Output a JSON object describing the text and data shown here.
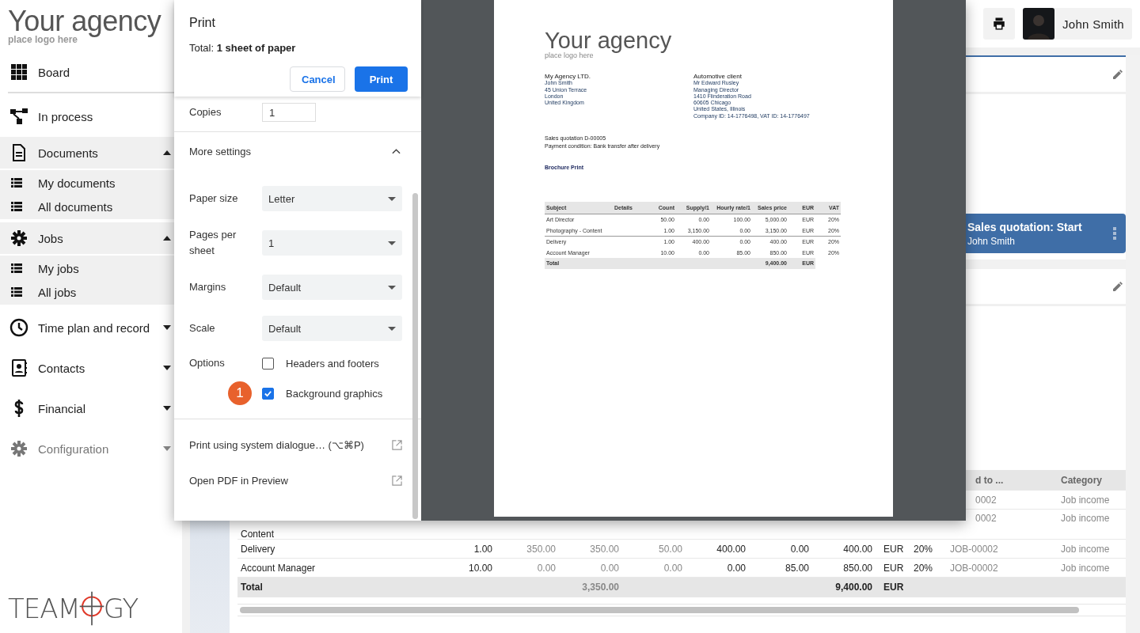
{
  "brand": {
    "name": "Your agency",
    "tagline": "place logo here"
  },
  "sidebar": {
    "items": [
      {
        "label": "Board",
        "disabled": false
      },
      {
        "label": "In process",
        "disabled": false
      },
      {
        "label": "Documents",
        "disabled": false,
        "expanded": true,
        "children": [
          {
            "label": "My documents"
          },
          {
            "label": "All documents"
          }
        ]
      },
      {
        "label": "Jobs",
        "disabled": false,
        "expanded": true,
        "children": [
          {
            "label": "My jobs"
          },
          {
            "label": "All jobs"
          }
        ]
      },
      {
        "label": "Time plan and record",
        "disabled": false,
        "expanded": false
      },
      {
        "label": "Contacts",
        "disabled": false,
        "expanded": false
      },
      {
        "label": "Financial",
        "disabled": false,
        "expanded": false
      },
      {
        "label": "Configuration",
        "disabled": true,
        "expanded": false
      }
    ],
    "footer_logo": {
      "left": "TEAM",
      "right": "GY"
    }
  },
  "header": {
    "user": {
      "name": "John Smith"
    }
  },
  "board": {
    "card": {
      "title": "Sales quotation: Start",
      "subtitle": "John Smith"
    }
  },
  "table": {
    "header": {
      "job": "d to ...",
      "category": "Category"
    },
    "rows": [
      {
        "kind": "item",
        "job": "0002",
        "category": "Job income"
      },
      {
        "kind": "item",
        "subject": "Content",
        "job": "0002",
        "category": "Job income"
      },
      {
        "kind": "item",
        "subject": "Delivery",
        "values": [
          "1.00",
          "350.00",
          "350.00",
          "50.00",
          "400.00",
          "0.00",
          "400.00"
        ],
        "currency": "EUR",
        "vat": "20%",
        "job": "JOB-00002",
        "category": "Job income"
      },
      {
        "kind": "item",
        "subject": "Account Manager",
        "values": [
          "10.00",
          "0.00",
          "0.00",
          "0.00",
          "0.00",
          "85.00",
          "850.00"
        ],
        "currency": "EUR",
        "vat": "20%",
        "job": "JOB-00002",
        "category": "Job income"
      },
      {
        "kind": "total",
        "subject": "Total",
        "column_4": "3,350.00",
        "column_8": "9,400.00",
        "currency": "EUR"
      }
    ]
  },
  "print_dialog": {
    "title": "Print",
    "total": "Total: **1 sheet of paper**",
    "buttons": [
      {
        "label": "Cancel",
        "kind": "secondary"
      },
      {
        "label": "Print",
        "kind": "primary"
      }
    ],
    "copies": {
      "label": "Copies",
      "value": "1"
    },
    "more_settings": {
      "label": "More settings",
      "expanded": true
    },
    "settings": [
      {
        "label": "Paper size",
        "value": "Letter"
      },
      {
        "label": "Pages per sheet",
        "value": "1"
      },
      {
        "label": "Margins",
        "value": "Default"
      },
      {
        "label": "Scale",
        "value": "Default"
      }
    ],
    "options": {
      "label": "Options",
      "items": [
        {
          "label": "Headers and footers",
          "checked": false
        },
        {
          "label": "Background graphics",
          "checked": true,
          "badge": "1"
        }
      ]
    },
    "links": [
      "Print using system dialogue… (⌥⌘P)",
      "Open PDF in Preview"
    ]
  },
  "document": {
    "brand": {
      "name": "Your agency",
      "tagline": "place logo here"
    },
    "sender": [
      "My Agency LTD.",
      "John Smith",
      "45 Union Terrace",
      "London",
      "United Kingdom"
    ],
    "recipient": [
      "Automotive client",
      "Mr Edward Rusley",
      "Managing Director",
      "1410 Flinderation Road",
      "60605 Chicago",
      "United States, Illinois",
      "Company ID: 14-1776498, VAT ID: 14-1776497"
    ],
    "quotation": "Sales quotation D-00005",
    "payment": "Payment condition: Bank transfer after delivery",
    "project": "Brochure Print",
    "table": {
      "columns": [
        "Subject",
        "Details",
        "Count",
        "Supply/1",
        "Hourly rate/1",
        "Sales price",
        "EUR",
        "VAT"
      ],
      "groups": [
        [
          {
            "subject": "Art Director",
            "count": "50.00",
            "supply": "0.00",
            "hourly": "100.00",
            "price": "5,000.00",
            "currency": "EUR",
            "vat": "20%"
          },
          {
            "subject": "Photography - Content",
            "count": "1.00",
            "supply": "3,150.00",
            "hourly": "0.00",
            "price": "3,150.00",
            "currency": "EUR",
            "vat": "20%"
          }
        ],
        [
          {
            "subject": "Delivery",
            "count": "1.00",
            "supply": "400.00",
            "hourly": "0.00",
            "price": "400.00",
            "currency": "EUR",
            "vat": "20%"
          },
          {
            "subject": "Account Manager",
            "count": "10.00",
            "supply": "0.00",
            "hourly": "85.00",
            "price": "850.00",
            "currency": "EUR",
            "vat": "20%"
          }
        ]
      ],
      "total": {
        "label": "Total",
        "price": "9,400.00",
        "currency": "EUR"
      }
    }
  }
}
